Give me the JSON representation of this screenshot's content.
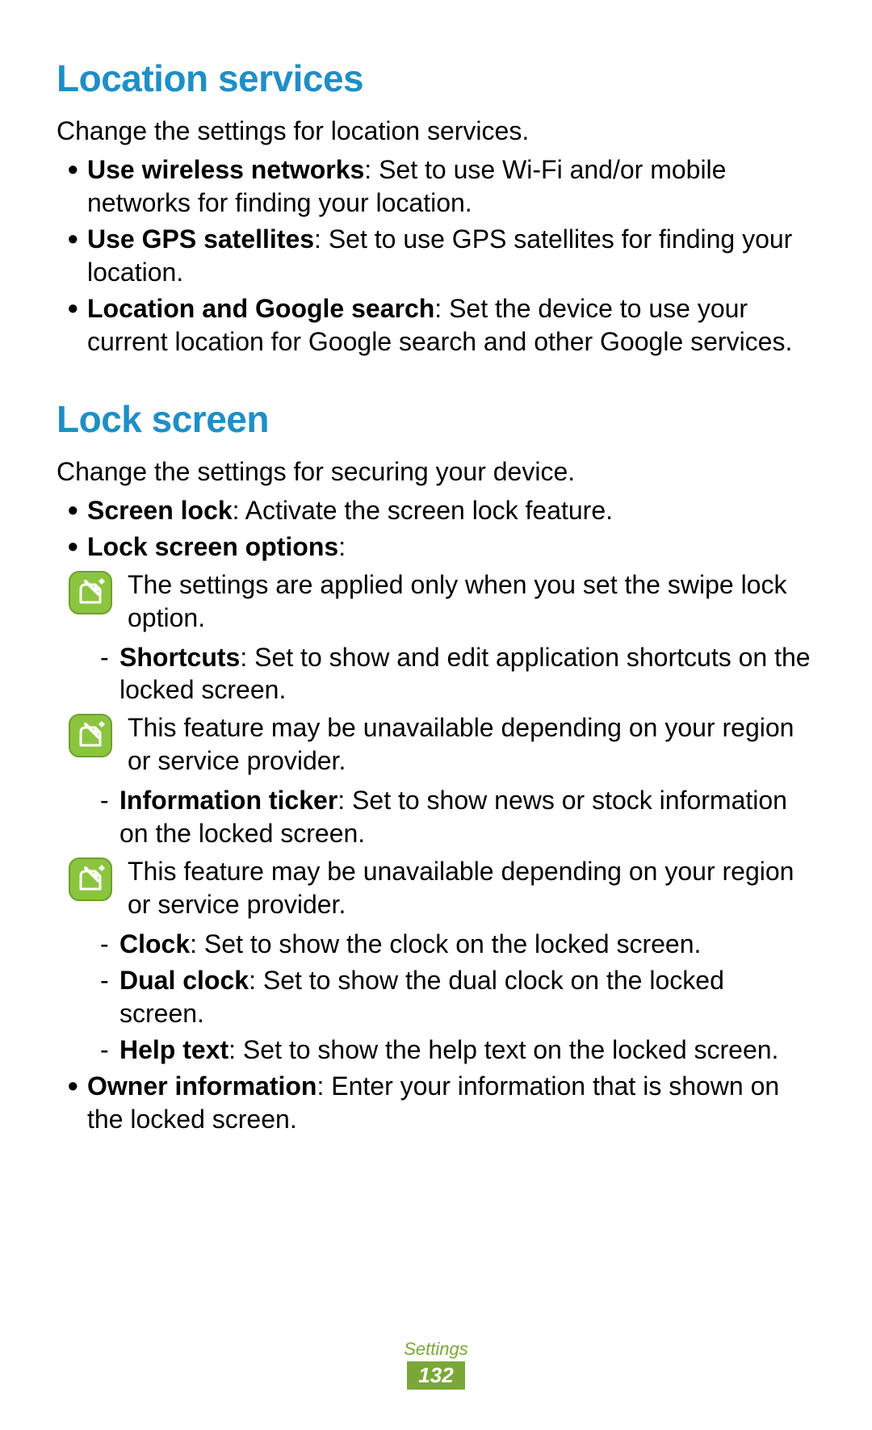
{
  "section1": {
    "heading": "Location services",
    "intro": "Change the settings for location services.",
    "items": [
      {
        "bold": "Use wireless networks",
        "rest": ": Set to use Wi-Fi and/or mobile networks for finding your location."
      },
      {
        "bold": "Use GPS satellites",
        "rest": ": Set to use GPS satellites for finding your location."
      },
      {
        "bold": "Location and Google search",
        "rest": ": Set the device to use your current location for Google search and other Google services."
      }
    ]
  },
  "section2": {
    "heading": "Lock screen",
    "intro": "Change the settings for securing your device.",
    "screen_lock": {
      "bold": "Screen lock",
      "rest": ": Activate the screen lock feature."
    },
    "lock_options_label": "Lock screen options",
    "lock_options_colon": ":",
    "note1": "The settings are applied only when you set the swipe lock option.",
    "shortcuts": {
      "bold": "Shortcuts",
      "rest": ": Set to show and edit application shortcuts on the locked screen."
    },
    "note2": "This feature may be unavailable depending on your region or service provider.",
    "info_ticker": {
      "bold": "Information ticker",
      "rest": ": Set to show news or stock information on the locked screen."
    },
    "note3": "This feature may be unavailable depending on your region or service provider.",
    "clock": {
      "bold": "Clock",
      "rest": ": Set to show the clock on the locked screen."
    },
    "dual_clock": {
      "bold": "Dual clock",
      "rest": ": Set to show the dual clock on the locked screen."
    },
    "help_text": {
      "bold": "Help text",
      "rest": ": Set to show the help text on the locked screen."
    },
    "owner_info": {
      "bold": "Owner information",
      "rest": ": Enter your information that is shown on the locked screen."
    }
  },
  "footer": {
    "label": "Settings",
    "page": "132"
  }
}
